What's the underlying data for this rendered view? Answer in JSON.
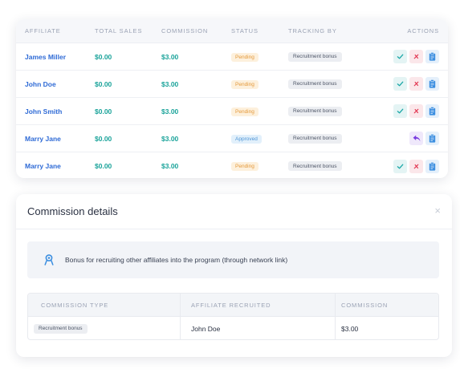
{
  "affiliates_table": {
    "headers": {
      "affiliate": "AFFILIATE",
      "total_sales": "TOTAL SALES",
      "commission": "COMMISSION",
      "status": "STATUS",
      "tracking_by": "TRACKING BY",
      "actions": "ACTIONS"
    },
    "rows": [
      {
        "affiliate": "James Miller",
        "total_sales": "$0.00",
        "commission": "$3.00",
        "status": "Pending",
        "tracking_by": "Recruitment bonus"
      },
      {
        "affiliate": "John Doe",
        "total_sales": "$0.00",
        "commission": "$3.00",
        "status": "Pending",
        "tracking_by": "Recruitment bonus"
      },
      {
        "affiliate": "John Smith",
        "total_sales": "$0.00",
        "commission": "$3.00",
        "status": "Pending",
        "tracking_by": "Recruitment bonus"
      },
      {
        "affiliate": "Marry Jane",
        "total_sales": "$0.00",
        "commission": "$3.00",
        "status": "Approved",
        "tracking_by": "Recruitment bonus"
      },
      {
        "affiliate": "Marry Jane",
        "total_sales": "$0.00",
        "commission": "$3.00",
        "status": "Pending",
        "tracking_by": "Recruitment bonus"
      }
    ]
  },
  "icons": {
    "approve": "check-icon",
    "reject": "x-icon",
    "details": "clipboard-icon",
    "undo": "undo-icon",
    "info": "map-pin-icon",
    "close": "close-icon"
  },
  "colors": {
    "link": "#2f6bd6",
    "money": "#1aa39a",
    "pending": "#e4993b",
    "approved": "#4f95d6",
    "approve_icon": "#19a6a6",
    "reject_icon": "#e2344f",
    "details_icon": "#3b8ee0",
    "undo_icon": "#7a3ce0"
  },
  "commission_details": {
    "title": "Commission details",
    "close": "×",
    "info_text": "Bonus for recruiting other affiliates into the program (through network link)",
    "headers": {
      "commission_type": "COMMISSION TYPE",
      "affiliate_recruited": "AFFILIATE RECRUITED",
      "commission": "COMMISSION"
    },
    "row": {
      "commission_type": "Recruitment bonus",
      "affiliate_recruited": "John Doe",
      "commission": "$3.00"
    }
  }
}
